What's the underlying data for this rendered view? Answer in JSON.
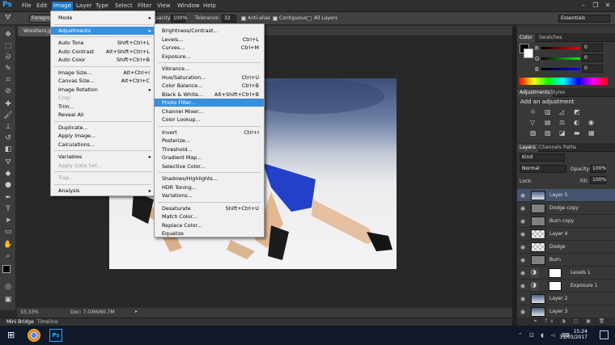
{
  "menubar": {
    "app_icon": "Ps",
    "items": [
      "File",
      "Edit",
      "Image",
      "Layer",
      "Type",
      "Select",
      "Filter",
      "View",
      "Window",
      "Help"
    ],
    "active": "Image"
  },
  "options_bar": {
    "sample": "Foregro",
    "opacity_label": "pacity:",
    "opacity_value": "100%",
    "tolerance_label": "Tolerance:",
    "tolerance_value": "32",
    "antialias": "Anti-alias",
    "contiguous": "Contiguous",
    "all_layers": "All Layers",
    "workspace": "Essentials"
  },
  "document": {
    "tab": "Wrestlers.jp",
    "zoom": "33.33%",
    "doc_info": "Doc: 7.03M/60.7M"
  },
  "bottom_tabs": [
    "Mini Bridge",
    "Timeline"
  ],
  "image_menu": [
    {
      "label": "Mode",
      "shortcut": "",
      "arrow": true
    },
    {
      "sep": true
    },
    {
      "label": "Adjustments",
      "shortcut": "",
      "arrow": true,
      "highlight": true
    },
    {
      "sep": true
    },
    {
      "label": "Auto Tone",
      "shortcut": "Shift+Ctrl+L"
    },
    {
      "label": "Auto Contrast",
      "shortcut": "Alt+Shift+Ctrl+L"
    },
    {
      "label": "Auto Color",
      "shortcut": "Shift+Ctrl+B"
    },
    {
      "sep": true
    },
    {
      "label": "Image Size...",
      "shortcut": "Alt+Ctrl+I"
    },
    {
      "label": "Canvas Size...",
      "shortcut": "Alt+Ctrl+C"
    },
    {
      "label": "Image Rotation",
      "shortcut": "",
      "arrow": true
    },
    {
      "label": "Crop",
      "shortcut": "",
      "disabled": true
    },
    {
      "label": "Trim...",
      "shortcut": ""
    },
    {
      "label": "Reveal All",
      "shortcut": ""
    },
    {
      "sep": true
    },
    {
      "label": "Duplicate...",
      "shortcut": ""
    },
    {
      "label": "Apply Image...",
      "shortcut": ""
    },
    {
      "label": "Calculations...",
      "shortcut": ""
    },
    {
      "sep": true
    },
    {
      "label": "Variables",
      "shortcut": "",
      "arrow": true
    },
    {
      "label": "Apply Data Set...",
      "shortcut": "",
      "disabled": true
    },
    {
      "sep": true
    },
    {
      "label": "Trap...",
      "shortcut": "",
      "disabled": true
    },
    {
      "sep": true
    },
    {
      "label": "Analysis",
      "shortcut": "",
      "arrow": true
    }
  ],
  "adjustments_menu": [
    {
      "label": "Brightness/Contrast...",
      "shortcut": ""
    },
    {
      "label": "Levels...",
      "shortcut": "Ctrl+L"
    },
    {
      "label": "Curves...",
      "shortcut": "Ctrl+M"
    },
    {
      "label": "Exposure...",
      "shortcut": ""
    },
    {
      "sep": true
    },
    {
      "label": "Vibrance...",
      "shortcut": ""
    },
    {
      "label": "Hue/Saturation...",
      "shortcut": "Ctrl+U"
    },
    {
      "label": "Color Balance...",
      "shortcut": "Ctrl+B"
    },
    {
      "label": "Black & White...",
      "shortcut": "Alt+Shift+Ctrl+B"
    },
    {
      "label": "Photo Filter...",
      "shortcut": "",
      "highlight": true
    },
    {
      "label": "Channel Mixer...",
      "shortcut": ""
    },
    {
      "label": "Color Lookup...",
      "shortcut": ""
    },
    {
      "sep": true
    },
    {
      "label": "Invert",
      "shortcut": "Ctrl+I"
    },
    {
      "label": "Posterize...",
      "shortcut": ""
    },
    {
      "label": "Threshold...",
      "shortcut": ""
    },
    {
      "label": "Gradient Map...",
      "shortcut": ""
    },
    {
      "label": "Selective Color...",
      "shortcut": ""
    },
    {
      "sep": true
    },
    {
      "label": "Shadows/Highlights...",
      "shortcut": ""
    },
    {
      "label": "HDR Toning...",
      "shortcut": ""
    },
    {
      "label": "Variations...",
      "shortcut": ""
    },
    {
      "sep": true
    },
    {
      "label": "Desaturate",
      "shortcut": "Shift+Ctrl+U"
    },
    {
      "label": "Match Color...",
      "shortcut": ""
    },
    {
      "label": "Replace Color...",
      "shortcut": ""
    },
    {
      "label": "Equalize",
      "shortcut": ""
    }
  ],
  "color_panel": {
    "tabs": [
      "Color",
      "Swatches"
    ],
    "channels": [
      {
        "name": "R",
        "value": "0"
      },
      {
        "name": "G",
        "value": "0"
      },
      {
        "name": "B",
        "value": "0"
      }
    ]
  },
  "adjust_panel": {
    "tabs": [
      "Adjustments",
      "Styles"
    ],
    "title": "Add an adjustment"
  },
  "layers_panel": {
    "tabs": [
      "Layers",
      "Channels",
      "Paths"
    ],
    "kind": "Kind",
    "blend": "Normal",
    "opacity_label": "Opacity:",
    "opacity_value": "100%",
    "lock_label": "Lock:",
    "fill_label": "Fill:",
    "fill_value": "100%",
    "layers": [
      {
        "name": "Layer 5",
        "selected": true,
        "thumb": "photo"
      },
      {
        "name": "Dodge copy",
        "thumb": "gray"
      },
      {
        "name": "Burn copy",
        "thumb": "gray"
      },
      {
        "name": "Layer 4",
        "thumb": "checker"
      },
      {
        "name": "Dodge",
        "thumb": "checker"
      },
      {
        "name": "Burn",
        "thumb": "gray"
      },
      {
        "name": "Levels 1",
        "thumb": "adj"
      },
      {
        "name": "Exposure 1",
        "thumb": "adj"
      },
      {
        "name": "Layer 2",
        "thumb": "photo"
      },
      {
        "name": "Layer 3",
        "thumb": "photo"
      }
    ]
  },
  "taskbar": {
    "time": "15:24",
    "date": "31/03/2017"
  },
  "colors": {
    "accent": "#3a8fdc",
    "menu_bg": "#f0f0f0",
    "panel_bg": "#383838",
    "taskbar": "#10182a"
  }
}
